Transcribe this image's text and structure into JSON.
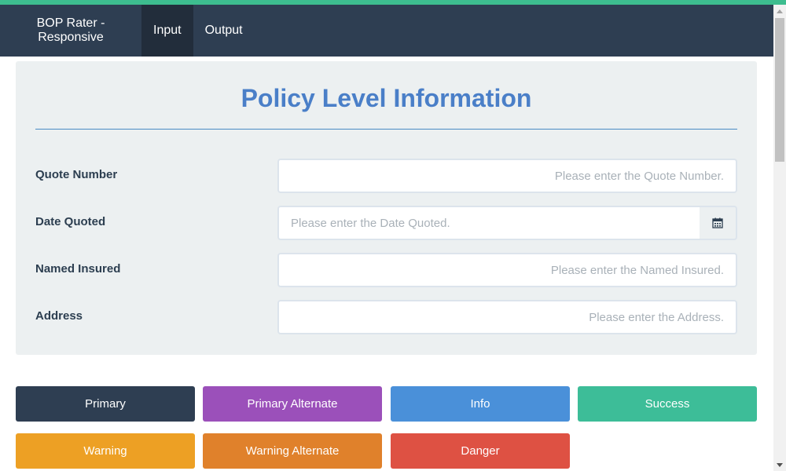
{
  "navbar": {
    "brand": "BOP Rater - Responsive",
    "items": [
      {
        "label": "Input",
        "active": true
      },
      {
        "label": "Output",
        "active": false
      }
    ]
  },
  "panel": {
    "title": "Policy Level Information",
    "fields": [
      {
        "label": "Quote Number",
        "placeholder": "Please enter the Quote Number.",
        "value": ""
      },
      {
        "label": "Date Quoted",
        "placeholder": "Please enter the Date Quoted.",
        "value": "",
        "icon": "calendar-icon"
      },
      {
        "label": "Named Insured",
        "placeholder": "Please enter the Named Insured.",
        "value": ""
      },
      {
        "label": "Address",
        "placeholder": "Please enter the Address.",
        "value": ""
      }
    ]
  },
  "buttons": [
    {
      "label": "Primary",
      "color": "#2e3e52"
    },
    {
      "label": "Primary Alternate",
      "color": "#9b50ba"
    },
    {
      "label": "Info",
      "color": "#4a90d9"
    },
    {
      "label": "Success",
      "color": "#3dbd98"
    },
    {
      "label": "Warning",
      "color": "#eda024"
    },
    {
      "label": "Warning Alternate",
      "color": "#e0812b"
    },
    {
      "label": "Danger",
      "color": "#de5143"
    }
  ],
  "colors": {
    "accent": "#3dbd8f",
    "navbar": "#2e3e52",
    "title": "#4a7fc8"
  }
}
